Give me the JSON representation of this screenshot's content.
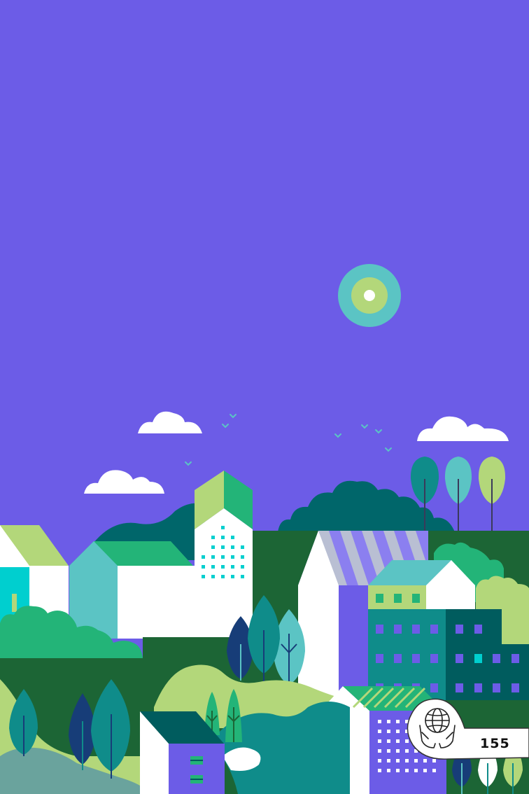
{
  "colors": {
    "sky": "#6c5ce7",
    "white": "#ffffff",
    "teal": "#5bc4c4",
    "light_green": "#b3d77a",
    "green": "#23b478",
    "dark_teal": "#00666a",
    "dark_green": "#1c6535",
    "navy": "#173d78",
    "deep_teal": "#005c5e",
    "cyan": "#00cfcf",
    "mid_teal": "#0f8c8a"
  },
  "badge": {
    "icon": "globe-in-hands-icon",
    "count": "155"
  }
}
